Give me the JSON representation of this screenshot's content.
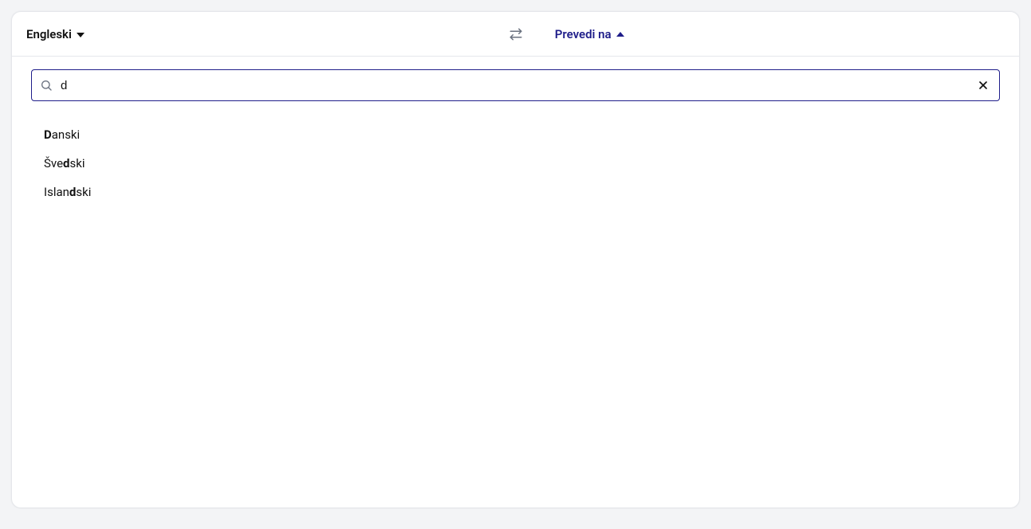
{
  "header": {
    "source_language": "Engleski",
    "target_label": "Prevedi na"
  },
  "search": {
    "value": "d"
  },
  "results": [
    {
      "pre": "",
      "match": "D",
      "post": "anski"
    },
    {
      "pre": "Šve",
      "match": "d",
      "post": "ski"
    },
    {
      "pre": "Islan",
      "match": "d",
      "post": "ski"
    }
  ]
}
